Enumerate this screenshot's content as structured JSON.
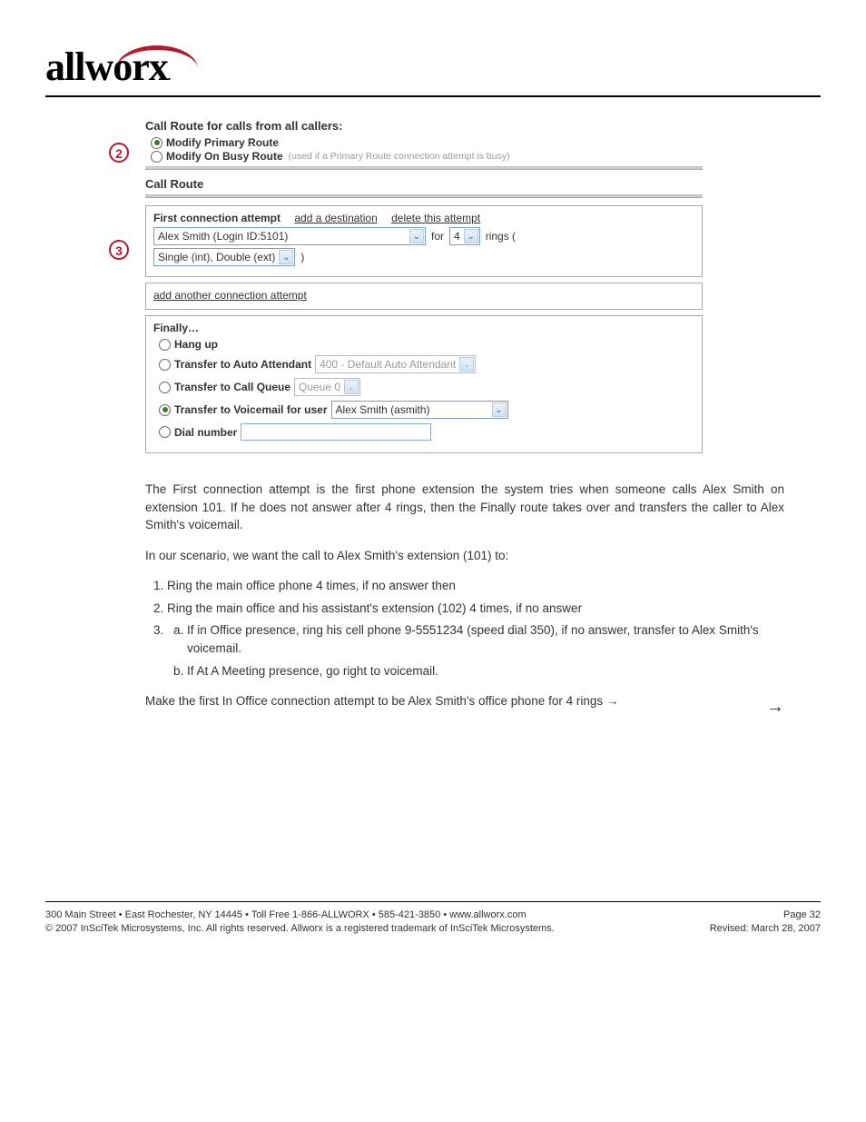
{
  "logo_text": "allworx",
  "route": {
    "header": "Call Route for calls from all callers:",
    "opt_primary": "Modify Primary Route",
    "opt_busy": "Modify On Busy Route",
    "opt_busy_hint": "(used if a Primary Route connection attempt is busy)",
    "callroute_label": "Call Route",
    "first_attempt": "First connection attempt",
    "add_dest": "add a destination",
    "delete_attempt": "delete this attempt",
    "user_select": "Alex Smith (Login ID:5101)",
    "for_text": "for",
    "ring_count": "4",
    "rings_paren": "rings (",
    "ring_type": "Single (int), Double (ext)",
    "close_paren": ")",
    "add_another": "add another connection attempt",
    "finally": "Finally…",
    "hangup": "Hang up",
    "transfer_aa": "Transfer to Auto Attendant",
    "aa_value": "400 - Default Auto Attendant",
    "transfer_queue": "Transfer to Call Queue",
    "queue_value": "Queue 0",
    "transfer_vm": "Transfer to Voicemail for user",
    "vm_user": "Alex Smith (asmith)",
    "dial_number": "Dial number"
  },
  "steps": {
    "two": "2",
    "three": "3"
  },
  "body": {
    "p1": "The First connection attempt is the first phone extension the system tries when someone calls Alex Smith on extension 101. If he does not answer after 4 rings, then the Finally route takes over and transfers the caller to Alex Smith's voicemail.",
    "p2_lead": "In our scenario, we want the call to Alex Smith's extension (101) to:",
    "li1": "Ring the main office phone 4 times, if no answer then",
    "li2": "Ring the main office and his assistant's extension (102) 4 times, if no answer",
    "li3a": "If in Office presence, ring his cell phone 9-5551234 (speed dial 350), if no answer, transfer to Alex Smith's voicemail.",
    "li3b": "If At A Meeting presence, go right to voicemail.",
    "p3": "Make the first In Office connection attempt to be Alex Smith's office phone for 4 rings →"
  },
  "footer": {
    "left1": "300 Main Street • East Rochester, NY 14445 • Toll Free 1-866-ALLWORX • 585-421-3850 • www.allworx.com",
    "left2": "© 2007 InSciTek Microsystems, Inc. All rights reserved. Allworx is a registered trademark of InSciTek Microsystems.",
    "right2": "Revised: March 28, 2007",
    "page": "Page 32"
  }
}
